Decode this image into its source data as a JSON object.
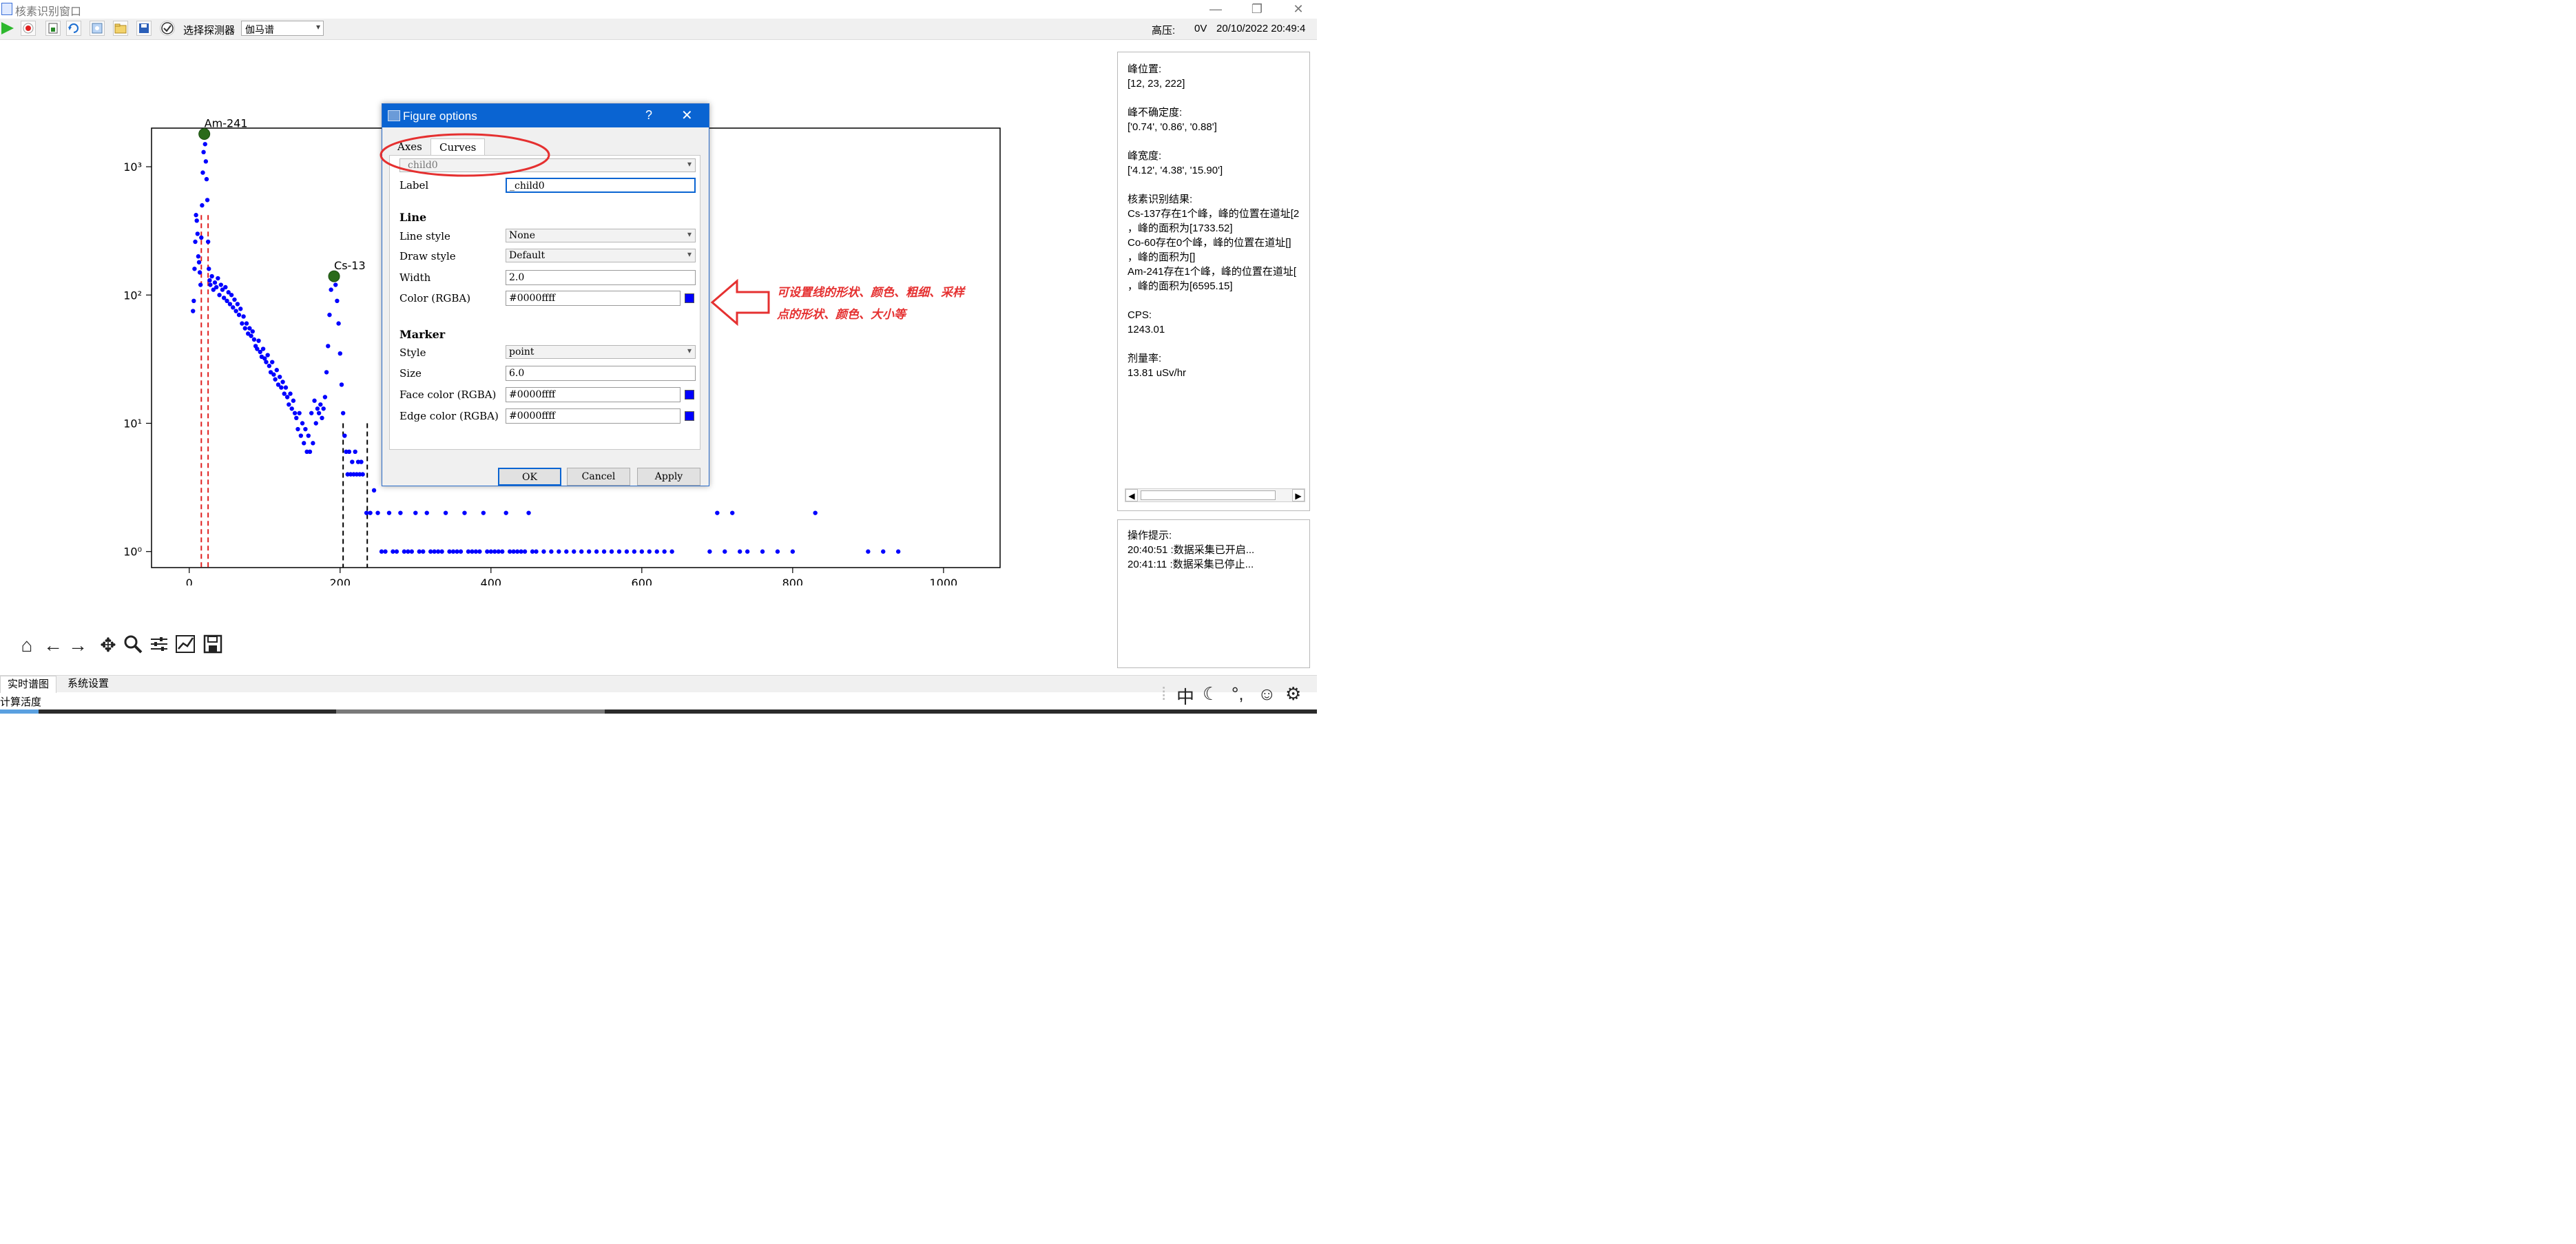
{
  "window": {
    "title": "核素识别窗口",
    "minimize": "—",
    "restore": "❐",
    "close": "✕"
  },
  "toolbar": {
    "detector_label": "选择探测器",
    "detector_value": "伽马谱",
    "hv_label": "高压:",
    "hv_value": "0V",
    "datetime": "20/10/2022 20:49:4"
  },
  "chart_data": {
    "type": "scatter",
    "yscale": "log",
    "xlim": [
      -50,
      1075
    ],
    "ylim": [
      0.75,
      2000
    ],
    "xticks": [
      0,
      200,
      400,
      600,
      800,
      1000
    ],
    "yticks": [
      {
        "value": 1,
        "label": "10⁰"
      },
      {
        "value": 10,
        "label": "10¹"
      },
      {
        "value": 100,
        "label": "10²"
      },
      {
        "value": 1000,
        "label": "10³"
      }
    ],
    "color": "#0000ff",
    "series": [
      {
        "points": [
          [
            5,
            75
          ],
          [
            6,
            90
          ],
          [
            7,
            160
          ],
          [
            8,
            260
          ],
          [
            9,
            420
          ],
          [
            10,
            380
          ],
          [
            11,
            300
          ],
          [
            12,
            200
          ],
          [
            13,
            180
          ],
          [
            14,
            150
          ],
          [
            15,
            120
          ],
          [
            16,
            280
          ],
          [
            17,
            500
          ],
          [
            18,
            900
          ],
          [
            19,
            1300
          ],
          [
            20,
            1800
          ],
          [
            21,
            1500
          ],
          [
            22,
            1100
          ],
          [
            23,
            800
          ],
          [
            24,
            550
          ],
          [
            25,
            260
          ],
          [
            26,
            160
          ],
          [
            27,
            130
          ],
          [
            28,
            120
          ],
          [
            30,
            140
          ],
          [
            32,
            110
          ],
          [
            34,
            125
          ],
          [
            36,
            115
          ],
          [
            38,
            135
          ],
          [
            40,
            100
          ],
          [
            42,
            120
          ],
          [
            44,
            110
          ],
          [
            46,
            95
          ],
          [
            48,
            115
          ],
          [
            50,
            90
          ],
          [
            52,
            105
          ],
          [
            54,
            85
          ],
          [
            56,
            100
          ],
          [
            58,
            80
          ],
          [
            60,
            92
          ],
          [
            62,
            75
          ],
          [
            64,
            85
          ],
          [
            66,
            70
          ],
          [
            68,
            78
          ],
          [
            70,
            60
          ],
          [
            72,
            68
          ],
          [
            74,
            55
          ],
          [
            76,
            60
          ],
          [
            78,
            50
          ],
          [
            80,
            55
          ],
          [
            82,
            48
          ],
          [
            84,
            52
          ],
          [
            86,
            45
          ],
          [
            88,
            40
          ],
          [
            90,
            38
          ],
          [
            92,
            44
          ],
          [
            94,
            36
          ],
          [
            96,
            33
          ],
          [
            98,
            38
          ],
          [
            100,
            32
          ],
          [
            102,
            30
          ],
          [
            104,
            34
          ],
          [
            106,
            28
          ],
          [
            108,
            25
          ],
          [
            110,
            30
          ],
          [
            112,
            24
          ],
          [
            114,
            22
          ],
          [
            116,
            26
          ],
          [
            118,
            20
          ],
          [
            120,
            23
          ],
          [
            122,
            19
          ],
          [
            124,
            21
          ],
          [
            126,
            17
          ],
          [
            128,
            19
          ],
          [
            130,
            16
          ],
          [
            132,
            14
          ],
          [
            134,
            17
          ],
          [
            136,
            13
          ],
          [
            138,
            15
          ],
          [
            140,
            12
          ],
          [
            142,
            11
          ],
          [
            144,
            9
          ],
          [
            146,
            12
          ],
          [
            148,
            8
          ],
          [
            150,
            10
          ],
          [
            152,
            7
          ],
          [
            154,
            9
          ],
          [
            156,
            6
          ],
          [
            158,
            8
          ],
          [
            160,
            6
          ],
          [
            162,
            12
          ],
          [
            164,
            7
          ],
          [
            166,
            15
          ],
          [
            168,
            10
          ],
          [
            170,
            13
          ],
          [
            172,
            12
          ],
          [
            174,
            14
          ],
          [
            176,
            11
          ],
          [
            178,
            13
          ],
          [
            180,
            16
          ],
          [
            182,
            25
          ],
          [
            184,
            40
          ],
          [
            186,
            70
          ],
          [
            188,
            110
          ],
          [
            190,
            135
          ],
          [
            192,
            140
          ],
          [
            194,
            120
          ],
          [
            196,
            90
          ],
          [
            198,
            60
          ],
          [
            200,
            35
          ],
          [
            202,
            20
          ],
          [
            204,
            12
          ],
          [
            206,
            8
          ],
          [
            208,
            6
          ],
          [
            210,
            4
          ],
          [
            212,
            6
          ],
          [
            214,
            4
          ],
          [
            216,
            5
          ],
          [
            218,
            4
          ],
          [
            220,
            6
          ],
          [
            222,
            4
          ],
          [
            224,
            5
          ],
          [
            226,
            4
          ],
          [
            228,
            5
          ],
          [
            230,
            4
          ],
          [
            235,
            2
          ],
          [
            240,
            2
          ],
          [
            245,
            3
          ],
          [
            250,
            2
          ],
          [
            255,
            1
          ],
          [
            260,
            1
          ],
          [
            265,
            2
          ],
          [
            270,
            1
          ],
          [
            275,
            1
          ],
          [
            280,
            2
          ],
          [
            285,
            1
          ],
          [
            290,
            1
          ],
          [
            295,
            1
          ],
          [
            300,
            2
          ],
          [
            305,
            1
          ],
          [
            310,
            1
          ],
          [
            315,
            2
          ],
          [
            320,
            1
          ],
          [
            325,
            1
          ],
          [
            330,
            1
          ],
          [
            335,
            1
          ],
          [
            340,
            2
          ],
          [
            345,
            1
          ],
          [
            350,
            1
          ],
          [
            355,
            1
          ],
          [
            360,
            1
          ],
          [
            365,
            2
          ],
          [
            370,
            1
          ],
          [
            375,
            1
          ],
          [
            380,
            1
          ],
          [
            385,
            1
          ],
          [
            390,
            2
          ],
          [
            395,
            1
          ],
          [
            400,
            1
          ],
          [
            405,
            1
          ],
          [
            410,
            1
          ],
          [
            415,
            1
          ],
          [
            420,
            2
          ],
          [
            425,
            1
          ],
          [
            430,
            1
          ],
          [
            435,
            1
          ],
          [
            440,
            1
          ],
          [
            445,
            1
          ],
          [
            450,
            2
          ],
          [
            455,
            1
          ],
          [
            460,
            1
          ],
          [
            470,
            1
          ],
          [
            480,
            1
          ],
          [
            490,
            1
          ],
          [
            500,
            1
          ],
          [
            510,
            1
          ],
          [
            520,
            1
          ],
          [
            530,
            1
          ],
          [
            540,
            1
          ],
          [
            550,
            1
          ],
          [
            560,
            1
          ],
          [
            570,
            1
          ],
          [
            580,
            1
          ],
          [
            590,
            1
          ],
          [
            600,
            1
          ],
          [
            610,
            1
          ],
          [
            620,
            1
          ],
          [
            630,
            1
          ],
          [
            640,
            1
          ],
          [
            690,
            1
          ],
          [
            700,
            2
          ],
          [
            710,
            1
          ],
          [
            720,
            2
          ],
          [
            730,
            1
          ],
          [
            740,
            1
          ],
          [
            760,
            1
          ],
          [
            780,
            1
          ],
          [
            800,
            1
          ],
          [
            830,
            2
          ],
          [
            900,
            1
          ],
          [
            920,
            1
          ],
          [
            940,
            1
          ]
        ]
      }
    ],
    "peaks": [
      {
        "x": 20,
        "y": 1800,
        "label": "Am-241"
      },
      {
        "x": 192,
        "y": 140,
        "label": "Cs-13"
      }
    ],
    "red_vlines": [
      {
        "x": 16,
        "top": 420
      },
      {
        "x": 25,
        "top": 420
      }
    ],
    "black_vlines": [
      {
        "x": 204,
        "top": 10
      },
      {
        "x": 236,
        "top": 10
      }
    ]
  },
  "info_panel": {
    "text": "峰位置:\n[12, 23, 222]\n\n峰不确定度:\n['0.74', '0.86', '0.88']\n\n峰宽度:\n['4.12', '4.38', '15.90']\n\n核素识别结果:\nCs-137存在1个峰，峰的位置在道址[2\n，峰的面积为[1733.52]\nCo-60存在0个峰，峰的位置在道址[]\n，峰的面积为[]\nAm-241存在1个峰，峰的位置在道址[\n，峰的面积为[6595.15]\n\nCPS:\n1243.01\n\n剂量率:\n13.81 uSv/hr",
    "scroll_left": "◀",
    "scroll_right": "▶"
  },
  "log_panel": {
    "text": "操作提示:\n20:40:51 :数据采集已开启...\n20:41:11 :数据采集已停止..."
  },
  "tabs": [
    "实时谱图",
    "系统设置"
  ],
  "status_text": "计算活度",
  "ime": {
    "lang": "中"
  },
  "dialog": {
    "title": "Figure options",
    "help": "?",
    "close": "✕",
    "tabs": [
      "Axes",
      "Curves"
    ],
    "curve_select": "_child0",
    "label_label": "Label",
    "label_value": "_child0",
    "line_section": "Line",
    "line_style_label": "Line style",
    "line_style_value": "None",
    "draw_style_label": "Draw style",
    "draw_style_value": "Default",
    "width_label": "Width",
    "width_value": "2.0",
    "color_label": "Color (RGBA)",
    "color_value": "#0000ffff",
    "marker_section": "Marker",
    "style_label": "Style",
    "style_value": "point",
    "size_label": "Size",
    "size_value": "6.0",
    "face_label": "Face color (RGBA)",
    "face_value": "#0000ffff",
    "edge_label": "Edge color (RGBA)",
    "edge_value": "#0000ffff",
    "ok": "OK",
    "cancel": "Cancel",
    "apply": "Apply"
  },
  "annotation": {
    "line1": "可设置线的形状、颜色、粗细、采样",
    "line2": "点的形状、颜色、大小等",
    "color": "#e53030"
  }
}
